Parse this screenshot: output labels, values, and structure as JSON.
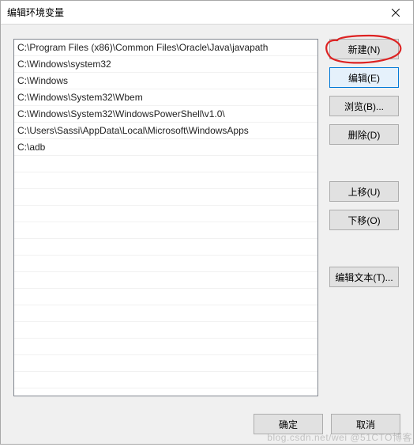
{
  "window": {
    "title": "编辑环境变量"
  },
  "paths": [
    "C:\\Program Files (x86)\\Common Files\\Oracle\\Java\\javapath",
    "C:\\Windows\\system32",
    "C:\\Windows",
    "C:\\Windows\\System32\\Wbem",
    "C:\\Windows\\System32\\WindowsPowerShell\\v1.0\\",
    "C:\\Users\\Sassi\\AppData\\Local\\Microsoft\\WindowsApps",
    "C:\\adb"
  ],
  "buttons": {
    "new": "新建(N)",
    "edit": "编辑(E)",
    "browse": "浏览(B)...",
    "delete": "删除(D)",
    "moveup": "上移(U)",
    "movedown": "下移(O)",
    "edittext": "编辑文本(T)...",
    "ok": "确定",
    "cancel": "取消"
  },
  "annotations": {
    "circle_color": "#d22",
    "watermark": "blog.csdn.net/wei @51CTO博客"
  }
}
